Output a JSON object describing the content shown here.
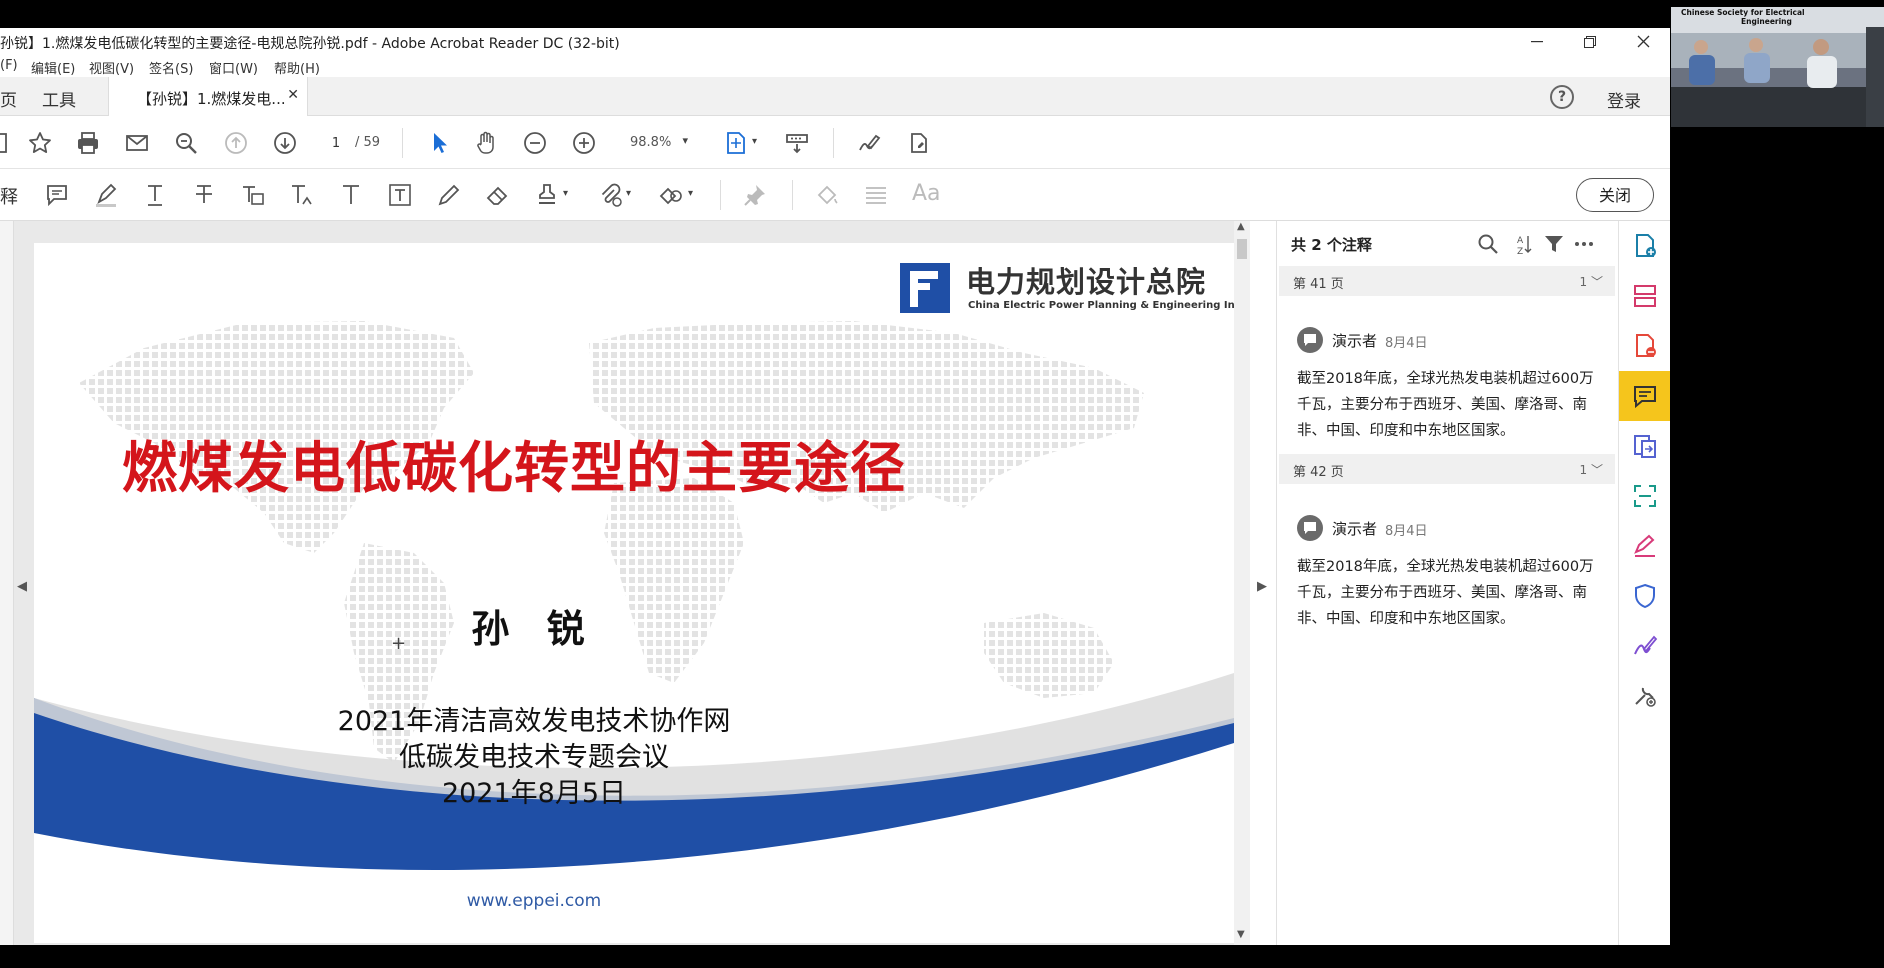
{
  "window": {
    "title": "孙锐】1.燃煤发电低碳化转型的主要途径-电规总院孙锐.pdf - Adobe Acrobat Reader DC (32-bit)"
  },
  "menu": [
    "(F)",
    "编辑(E)",
    "视图(V)",
    "签名(S)",
    "窗口(W)",
    "帮助(H)"
  ],
  "tabs": {
    "home": "页",
    "tools": "工具",
    "document": "【孙锐】1.燃煤发电...",
    "help": "?",
    "login": "登录"
  },
  "toolbar": {
    "current_page": "1",
    "total_pages": "/ 59",
    "zoom": "98.8%"
  },
  "comment_toolbar": {
    "label": "注释",
    "font_tool": "Aa",
    "close_label": "关闭"
  },
  "slide": {
    "logo_cn": "电力规划设计总院",
    "logo_en": "China Electric Power Planning & Engineering Institute",
    "title": "燃煤发电低碳化转型的主要途径",
    "author": "孙 锐",
    "conference_line1": "2021年清洁高效发电技术协作网",
    "conference_line2": "低碳发电技术专题会议",
    "date": "2021年8月5日",
    "website": "www.eppei.com"
  },
  "comments_panel": {
    "header": "共 2 个注释",
    "groups": [
      {
        "page": "第 41 页",
        "count": "1",
        "author": "演示者",
        "date": "8月4日",
        "text": "截至2018年底，全球光热发电装机超过600万千瓦，主要分布于西班牙、美国、摩洛哥、南非、中国、印度和中东地区国家。"
      },
      {
        "page": "第 42 页",
        "count": "1",
        "author": "演示者",
        "date": "8月4日",
        "text": "截至2018年底，全球光热发电装机超过600万千瓦，主要分布于西班牙、美国、摩洛哥、南非、中国、印度和中东地区国家。"
      }
    ]
  },
  "video": {
    "caption_line1": "Chinese Society for Electrical",
    "caption_line2": "Engineering"
  },
  "colors": {
    "title_red": "#d4151b",
    "brand_blue": "#1f4fa6",
    "rail_active": "#f5c51c",
    "link_blue": "#2f5aa5"
  }
}
